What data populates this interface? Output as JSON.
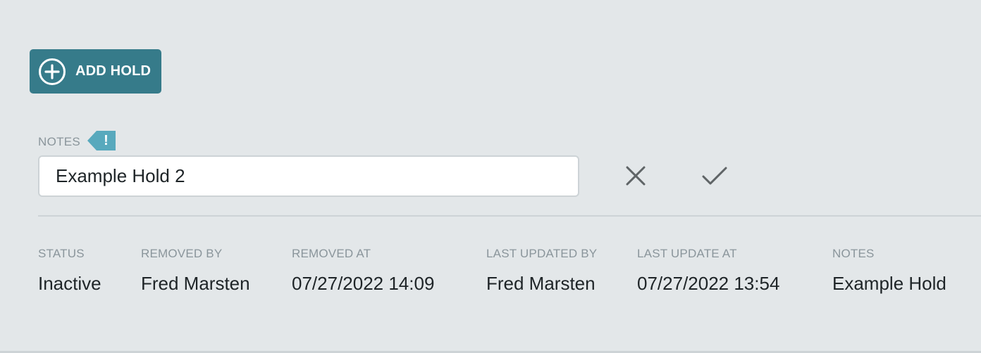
{
  "toolbar": {
    "add_hold_label": "ADD HOLD",
    "add_hold_icon": "plus-circle-icon",
    "button_color": "#367b8a"
  },
  "notes_editor": {
    "label": "NOTES",
    "required_flag": "!",
    "required_flag_color": "#58a9bd",
    "value": "Example Hold 2",
    "cancel_icon": "close-icon",
    "confirm_icon": "checkmark-icon"
  },
  "details": {
    "columns": [
      {
        "label": "STATUS",
        "value": "Inactive"
      },
      {
        "label": "REMOVED BY",
        "value": "Fred Marsten"
      },
      {
        "label": "REMOVED AT",
        "value": "07/27/2022 14:09"
      },
      {
        "label": "LAST UPDATED BY",
        "value": "Fred Marsten"
      },
      {
        "label": "LAST UPDATE AT",
        "value": "07/27/2022 13:54"
      },
      {
        "label": "NOTES",
        "value": "Example Hold"
      }
    ]
  }
}
